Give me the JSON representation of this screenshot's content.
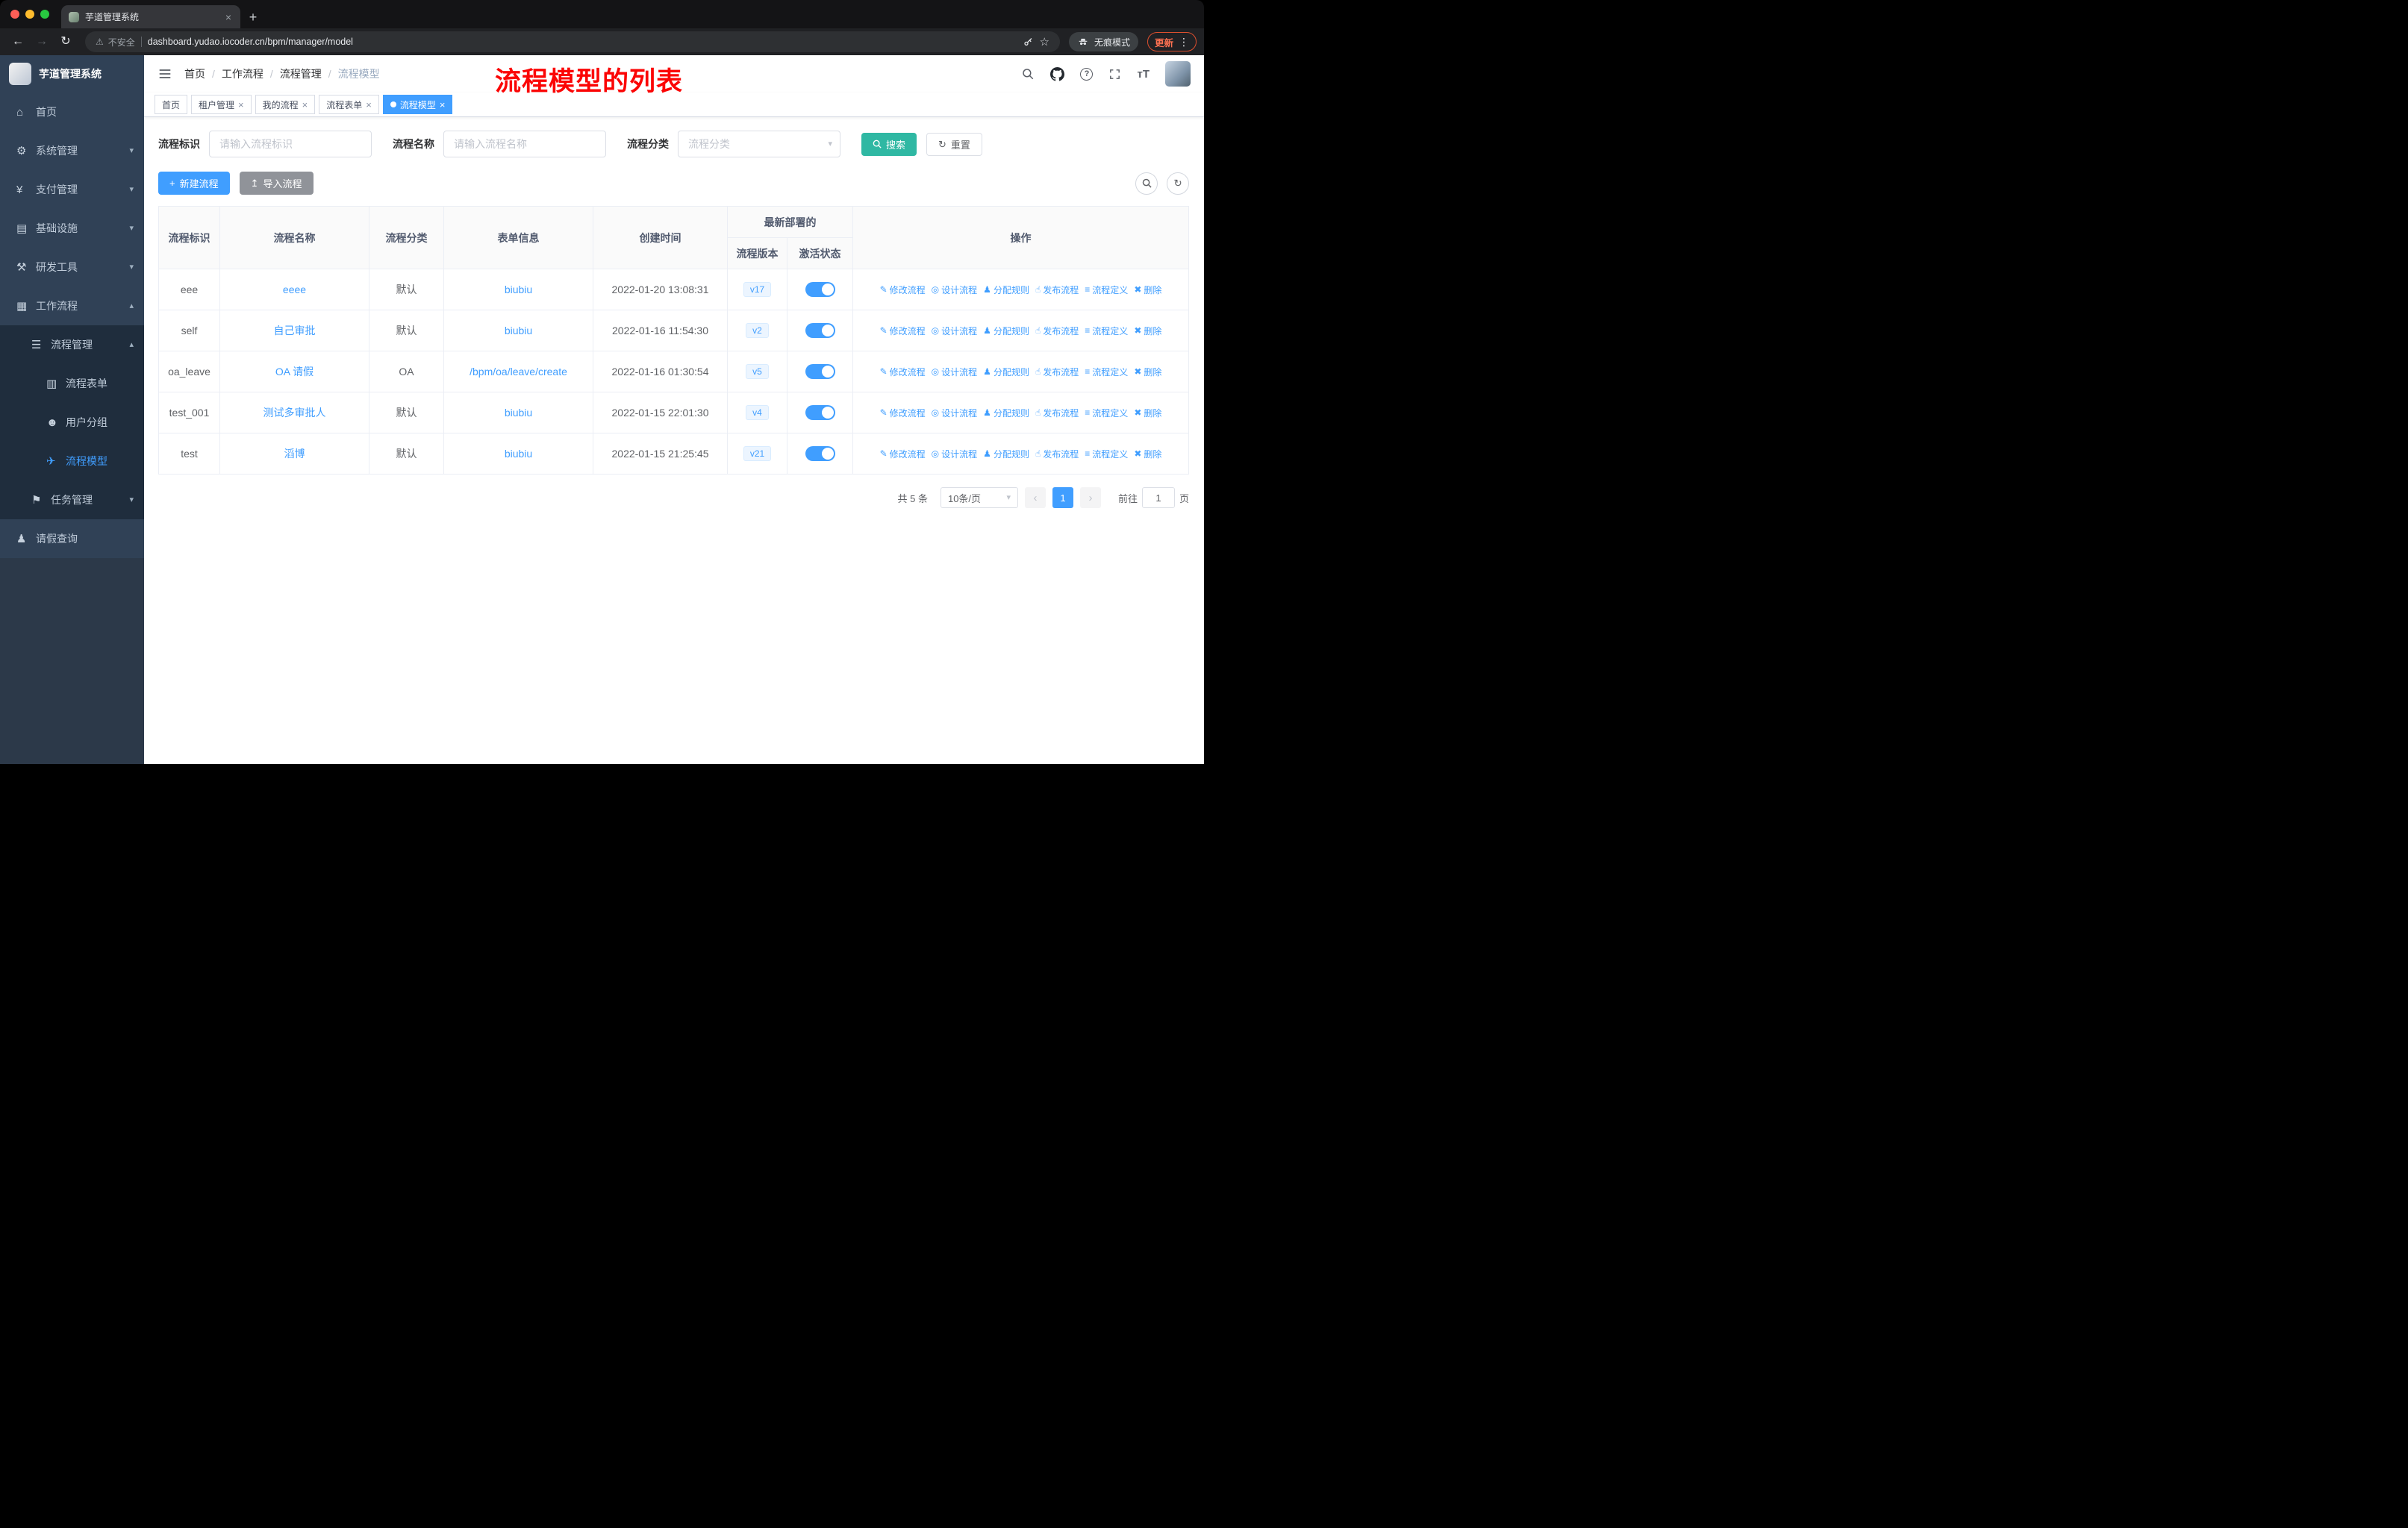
{
  "browser": {
    "tab_title": "芋道管理系统",
    "security_label": "不安全",
    "url": "dashboard.yudao.iocoder.cn/bpm/manager/model",
    "incognito_label": "无痕模式",
    "update_label": "更新"
  },
  "glyphs": {
    "home": "⌂",
    "system": "⚙",
    "pay": "¥",
    "infra": "▤",
    "devtool": "⚒",
    "workflow": "▦",
    "process_mgmt": "☰",
    "process_form": "▥",
    "user_group": "☻",
    "process_model": "✈",
    "task_mgmt": "⚑",
    "leave_query": "♟",
    "chevron_down": "▾",
    "chevron_up": "▴",
    "caret": "▾",
    "plus": "+",
    "upload": "↥",
    "refresh": "↻",
    "edit": "✎",
    "design": "◎",
    "assign": "♟",
    "publish": "☝",
    "define": "≡",
    "delete": "✖",
    "back": "←",
    "forward": "→",
    "reload": "↻",
    "star": "☆",
    "warning": "⚠",
    "dots": "⋮",
    "close": "×",
    "prev": "‹",
    "next": "›",
    "question": "?",
    "font_size": "тT"
  },
  "sidebar": {
    "app_title": "芋道管理系统",
    "items": [
      {
        "label": "首页"
      },
      {
        "label": "系统管理"
      },
      {
        "label": "支付管理"
      },
      {
        "label": "基础设施"
      },
      {
        "label": "研发工具"
      },
      {
        "label": "工作流程"
      },
      {
        "label": "流程管理"
      },
      {
        "label": "流程表单"
      },
      {
        "label": "用户分组"
      },
      {
        "label": "流程模型"
      },
      {
        "label": "任务管理"
      },
      {
        "label": "请假查询"
      }
    ]
  },
  "header": {
    "breadcrumb": [
      "首页",
      "工作流程",
      "流程管理",
      "流程模型"
    ],
    "annotation": "流程模型的列表"
  },
  "tags": [
    {
      "label": "首页"
    },
    {
      "label": "租户管理"
    },
    {
      "label": "我的流程"
    },
    {
      "label": "流程表单"
    },
    {
      "label": "流程模型"
    }
  ],
  "filters": {
    "id_label": "流程标识",
    "id_placeholder": "请输入流程标识",
    "name_label": "流程名称",
    "name_placeholder": "请输入流程名称",
    "category_label": "流程分类",
    "category_placeholder": "流程分类",
    "search_button": "搜索",
    "reset_button": "重置"
  },
  "toolbar": {
    "create_button": "新建流程",
    "import_button": "导入流程"
  },
  "table": {
    "headers": {
      "id": "流程标识",
      "name": "流程名称",
      "category": "流程分类",
      "form": "表单信息",
      "created": "创建时间",
      "deploy_group": "最新部署的",
      "version": "流程版本",
      "active": "激活状态",
      "actions": "操作"
    },
    "action_labels": [
      "修改流程",
      "设计流程",
      "分配规则",
      "发布流程",
      "流程定义",
      "删除"
    ],
    "rows": [
      {
        "id": "eee",
        "name": "eeee",
        "category": "默认",
        "form": "biubiu",
        "created": "2022-01-20 13:08:31",
        "version": "v17",
        "active": true
      },
      {
        "id": "self",
        "name": "自己审批",
        "category": "默认",
        "form": "biubiu",
        "created": "2022-01-16 11:54:30",
        "version": "v2",
        "active": true
      },
      {
        "id": "oa_leave",
        "name": "OA 请假",
        "category": "OA",
        "form": "/bpm/oa/leave/create",
        "created": "2022-01-16 01:30:54",
        "version": "v5",
        "active": true
      },
      {
        "id": "test_001",
        "name": "测试多审批人",
        "category": "默认",
        "form": "biubiu",
        "created": "2022-01-15 22:01:30",
        "version": "v4",
        "active": true
      },
      {
        "id": "test",
        "name": "滔博",
        "category": "默认",
        "form": "biubiu",
        "created": "2022-01-15 21:25:45",
        "version": "v21",
        "active": true
      }
    ]
  },
  "pagination": {
    "total": "共 5 条",
    "page_size": "10条/页",
    "current_page": "1",
    "goto_label": "前往",
    "goto_value": "1",
    "page_unit": "页"
  },
  "colors": {
    "accent": "#409eff",
    "search_button": "#2fb8a3",
    "annotation": "#fb0505",
    "sidebar_bg": "#304156",
    "submenu_bg": "#1f2d3d",
    "toggle_on": "#409eff"
  }
}
